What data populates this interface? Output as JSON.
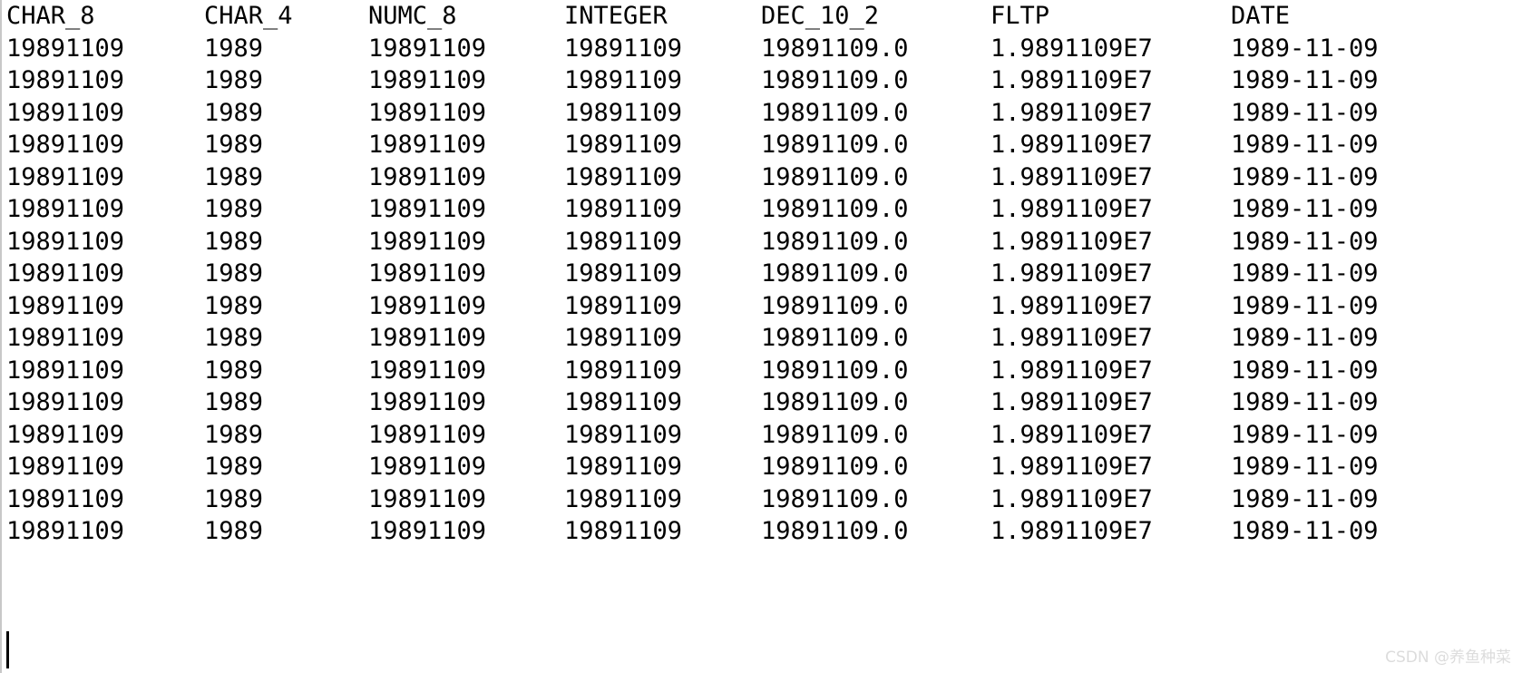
{
  "panel": {
    "background": "#ffffff",
    "text_color": "#000000",
    "border_color": "#c8c8c8"
  },
  "table": {
    "columns": [
      "CHAR_8",
      "CHAR_4",
      "NUMC_8",
      "INTEGER",
      "DEC_10_2",
      "FLTP",
      "DATE"
    ],
    "rows": [
      [
        "19891109",
        "1989",
        "19891109",
        "19891109",
        "19891109.0",
        "1.9891109E7",
        "1989-11-09"
      ],
      [
        "19891109",
        "1989",
        "19891109",
        "19891109",
        "19891109.0",
        "1.9891109E7",
        "1989-11-09"
      ],
      [
        "19891109",
        "1989",
        "19891109",
        "19891109",
        "19891109.0",
        "1.9891109E7",
        "1989-11-09"
      ],
      [
        "19891109",
        "1989",
        "19891109",
        "19891109",
        "19891109.0",
        "1.9891109E7",
        "1989-11-09"
      ],
      [
        "19891109",
        "1989",
        "19891109",
        "19891109",
        "19891109.0",
        "1.9891109E7",
        "1989-11-09"
      ],
      [
        "19891109",
        "1989",
        "19891109",
        "19891109",
        "19891109.0",
        "1.9891109E7",
        "1989-11-09"
      ],
      [
        "19891109",
        "1989",
        "19891109",
        "19891109",
        "19891109.0",
        "1.9891109E7",
        "1989-11-09"
      ],
      [
        "19891109",
        "1989",
        "19891109",
        "19891109",
        "19891109.0",
        "1.9891109E7",
        "1989-11-09"
      ],
      [
        "19891109",
        "1989",
        "19891109",
        "19891109",
        "19891109.0",
        "1.9891109E7",
        "1989-11-09"
      ],
      [
        "19891109",
        "1989",
        "19891109",
        "19891109",
        "19891109.0",
        "1.9891109E7",
        "1989-11-09"
      ],
      [
        "19891109",
        "1989",
        "19891109",
        "19891109",
        "19891109.0",
        "1.9891109E7",
        "1989-11-09"
      ],
      [
        "19891109",
        "1989",
        "19891109",
        "19891109",
        "19891109.0",
        "1.9891109E7",
        "1989-11-09"
      ],
      [
        "19891109",
        "1989",
        "19891109",
        "19891109",
        "19891109.0",
        "1.9891109E7",
        "1989-11-09"
      ],
      [
        "19891109",
        "1989",
        "19891109",
        "19891109",
        "19891109.0",
        "1.9891109E7",
        "1989-11-09"
      ],
      [
        "19891109",
        "1989",
        "19891109",
        "19891109",
        "19891109.0",
        "1.9891109E7",
        "1989-11-09"
      ],
      [
        "19891109",
        "1989",
        "19891109",
        "19891109",
        "19891109.0",
        "1.9891109E7",
        "1989-11-09"
      ]
    ]
  },
  "caret": {
    "visible": true
  },
  "watermark": {
    "text": "CSDN @养鱼种菜",
    "color": "#dcdcdc"
  }
}
